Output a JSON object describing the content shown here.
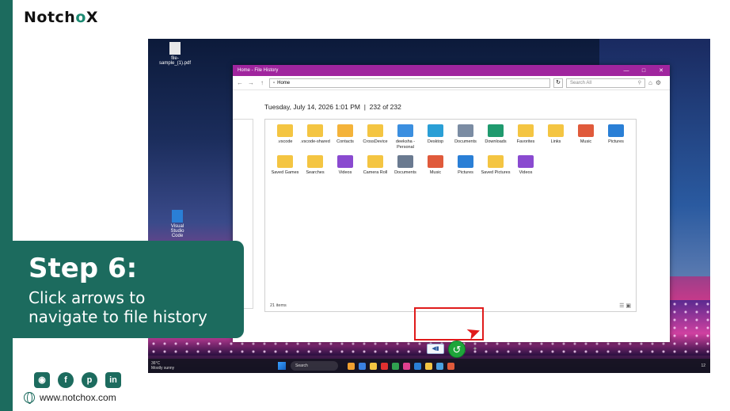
{
  "brand": {
    "logo_text_a": "Notch",
    "logo_text_b": "o",
    "logo_text_c": "X",
    "accent": "#1c6b5e",
    "highlight": "#e01b1b"
  },
  "desktop": {
    "icons": [
      {
        "label": "file-sample_(1).pdf"
      },
      {
        "label": "Visual Studio Code"
      }
    ]
  },
  "window": {
    "title": "Home - File History",
    "controls": [
      "minimize",
      "maximize",
      "close"
    ],
    "address": "Home",
    "search_placeholder": "Search All",
    "header_date": "Tuesday, July 14, 2026 1:01 PM",
    "header_sep": "|",
    "header_count": "232 of 232",
    "status": "21 items",
    "items": [
      {
        "label": ".vscode",
        "icon": "folder-icon",
        "color": "#f4c542"
      },
      {
        "label": ".vscode-shared",
        "icon": "folder-icon",
        "color": "#f4c542"
      },
      {
        "label": "Contacts",
        "icon": "contacts-icon",
        "color": "#f4b33a"
      },
      {
        "label": "CrossDevice",
        "icon": "folder-icon",
        "color": "#f4c542"
      },
      {
        "label": "deeksha - Personal",
        "icon": "cloud-folder-icon",
        "color": "#3b8fe0"
      },
      {
        "label": "Desktop",
        "icon": "desktop-folder-icon",
        "color": "#2a9fd6"
      },
      {
        "label": "Documents",
        "icon": "documents-folder-icon",
        "color": "#7b8ca3"
      },
      {
        "label": "Downloads",
        "icon": "downloads-folder-icon",
        "color": "#1f9a6e"
      },
      {
        "label": "Favorites",
        "icon": "favorites-folder-icon",
        "color": "#f4c542"
      },
      {
        "label": "Links",
        "icon": "links-folder-icon",
        "color": "#f4c542"
      },
      {
        "label": "Music",
        "icon": "music-folder-icon",
        "color": "#e05a3b"
      },
      {
        "label": "Pictures",
        "icon": "pictures-folder-icon",
        "color": "#2a7fd6"
      },
      {
        "label": "Saved Games",
        "icon": "saved-games-folder-icon",
        "color": "#f4c542"
      },
      {
        "label": "Searches",
        "icon": "searches-folder-icon",
        "color": "#f4c542"
      },
      {
        "label": "Videos",
        "icon": "videos-folder-icon",
        "color": "#8a4ad0"
      },
      {
        "label": "Camera Roll",
        "icon": "file-icon",
        "color": "#f4c542"
      },
      {
        "label": "Documents",
        "icon": "document-file-icon",
        "color": "#6a7a90"
      },
      {
        "label": "Music",
        "icon": "music-file-icon",
        "color": "#e05a3b"
      },
      {
        "label": "Pictures",
        "icon": "pictures-file-icon",
        "color": "#2a7fd6"
      },
      {
        "label": "Saved Pictures",
        "icon": "file-icon",
        "color": "#f4c542"
      },
      {
        "label": "Videos",
        "icon": "videos-file-icon",
        "color": "#8a4ad0"
      }
    ]
  },
  "taskbar": {
    "weather_temp": "36°C",
    "weather_desc": "Mostly sunny",
    "search_label": "Search",
    "clock": "12"
  },
  "step": {
    "title": "Step 6:",
    "line1": "Click arrows to",
    "line2": "navigate to file history"
  },
  "footer": {
    "website": "www.notchox.com",
    "socials": [
      "instagram-icon",
      "facebook-icon",
      "pinterest-icon",
      "linkedin-icon"
    ]
  }
}
